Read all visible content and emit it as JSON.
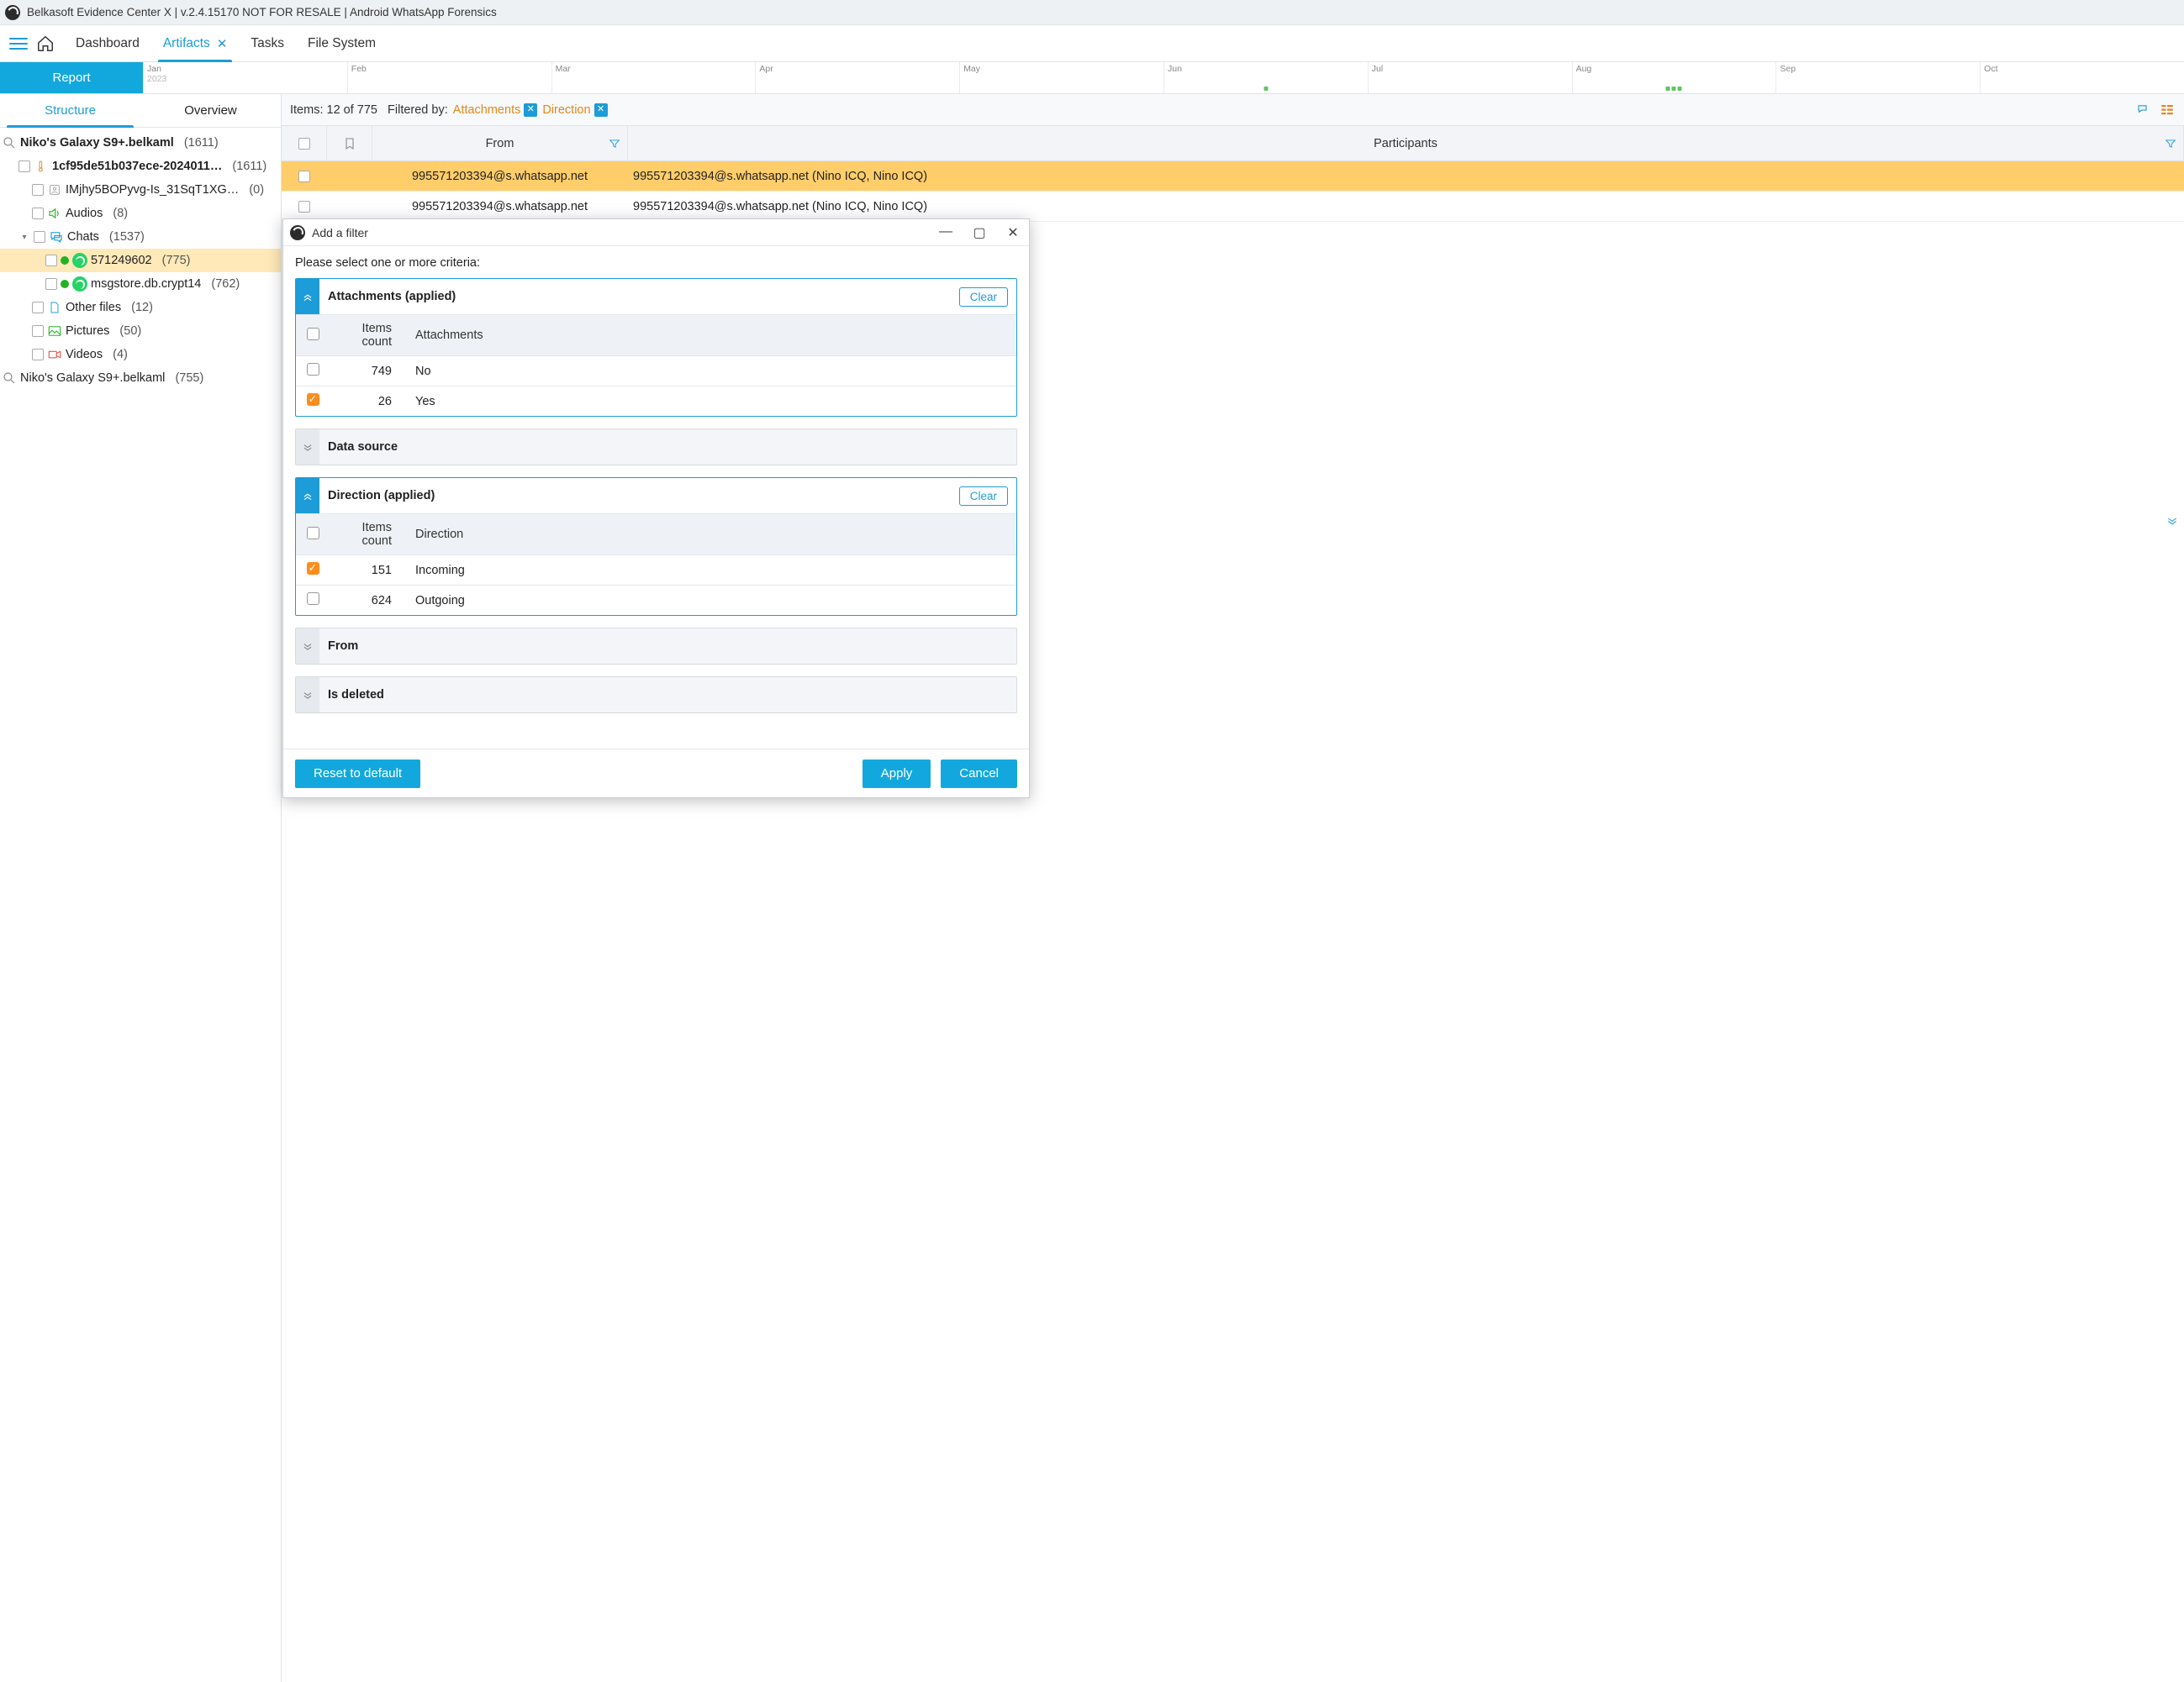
{
  "titlebar": "Belkasoft Evidence Center X | v.2.4.15170 NOT FOR RESALE | Android WhatsApp Forensics",
  "nav": {
    "dashboard": "Dashboard",
    "artifacts": "Artifacts",
    "tasks": "Tasks",
    "filesystem": "File System"
  },
  "report_btn": "Report",
  "timeline": {
    "months": [
      "Jan",
      "Feb",
      "Mar",
      "Apr",
      "May",
      "Jun",
      "Jul",
      "Aug",
      "Sep",
      "Oct"
    ],
    "year": "2023"
  },
  "left_tabs": {
    "structure": "Structure",
    "overview": "Overview"
  },
  "tree": {
    "root1": {
      "label": "Niko's Galaxy S9+.belkaml",
      "count": "(1611)"
    },
    "case": {
      "label": "1cf95de51b037ece-2024011…",
      "count": "(1611)"
    },
    "img": {
      "label": "IMjhy5BOPyvg-Is_31SqT1XG…",
      "count": "(0)"
    },
    "audios": {
      "label": "Audios",
      "count": "(8)"
    },
    "chats": {
      "label": "Chats",
      "count": "(1537)"
    },
    "chat_a": {
      "label": "571249602",
      "count": "(775)"
    },
    "chat_b": {
      "label": "msgstore.db.crypt14",
      "count": "(762)"
    },
    "other": {
      "label": "Other files",
      "count": "(12)"
    },
    "pict": {
      "label": "Pictures",
      "count": "(50)"
    },
    "vids": {
      "label": "Videos",
      "count": "(4)"
    },
    "root2": {
      "label": "Niko's Galaxy S9+.belkaml",
      "count": "(755)"
    }
  },
  "filterbar": {
    "items": "Items: 12 of 775",
    "filtered_by": "Filtered by:",
    "chips": [
      "Attachments",
      "Direction"
    ]
  },
  "grid": {
    "head_from": "From",
    "head_part": "Participants",
    "rows": [
      {
        "from": "995571203394@s.whatsapp.net",
        "part": "995571203394@s.whatsapp.net (Nino ICQ, Nino ICQ)"
      },
      {
        "from": "995571203394@s.whatsapp.net",
        "part": "995571203394@s.whatsapp.net (Nino ICQ, Nino ICQ)"
      }
    ]
  },
  "modal": {
    "title": "Add a filter",
    "prompt": "Please select one or more criteria:",
    "attachments": {
      "title": "Attachments (applied)",
      "clear": "Clear",
      "head_cnt": "Items count",
      "head_val": "Attachments",
      "rows": [
        {
          "cnt": "749",
          "val": "No",
          "checked": false
        },
        {
          "cnt": "26",
          "val": "Yes",
          "checked": true
        }
      ]
    },
    "datasource": {
      "title": "Data source"
    },
    "direction": {
      "title": "Direction (applied)",
      "clear": "Clear",
      "head_cnt": "Items count",
      "head_val": "Direction",
      "rows": [
        {
          "cnt": "151",
          "val": "Incoming",
          "checked": true
        },
        {
          "cnt": "624",
          "val": "Outgoing",
          "checked": false
        }
      ]
    },
    "from": {
      "title": "From"
    },
    "isdeleted": {
      "title": "Is deleted"
    },
    "reset": "Reset to default",
    "apply": "Apply",
    "cancel": "Cancel"
  }
}
